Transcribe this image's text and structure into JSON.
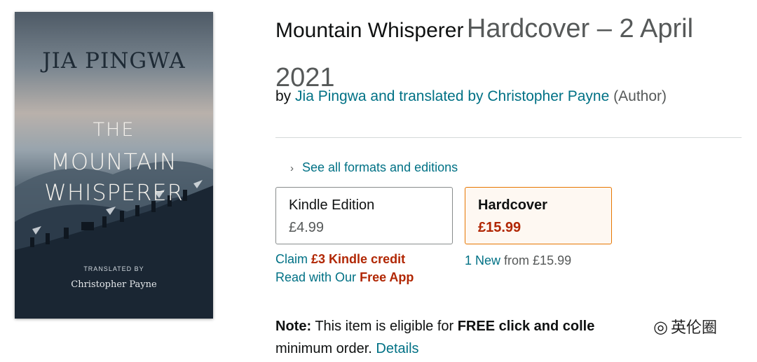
{
  "cover": {
    "author": "JIA PINGWA",
    "title_line1": "THE",
    "title_line2": "MOUNTAIN",
    "title_line3": "WHISPERER",
    "translated_by": "TRANSLATED BY",
    "translator": "Christopher Payne"
  },
  "product": {
    "title": "Mountain Whisperer",
    "format_date": "Hardcover – 2 April 2021",
    "by": "by",
    "authors_link": "Jia Pingwa and translated by Christopher Payne",
    "role": "(Author)"
  },
  "formats": {
    "see_all": "See all formats and editions",
    "kindle": {
      "name": "Kindle Edition",
      "price": "£4.99"
    },
    "hardcover": {
      "name": "Hardcover",
      "price": "£15.99"
    }
  },
  "kindle_offers": {
    "claim_prefix": "Claim",
    "claim_credit": "£3 Kindle credit",
    "read_prefix": "Read with Our",
    "free_app": "Free App"
  },
  "hardcover_offers": {
    "new_link": "1 New",
    "from_text": "from £15.99"
  },
  "note": {
    "label": "Note:",
    "text": "This item is eligible for",
    "bold": "FREE click and colle",
    "text2": "minimum order.",
    "details": "Details"
  },
  "watermark": {
    "icon": "wechat-icon",
    "text": "英伦圈"
  }
}
